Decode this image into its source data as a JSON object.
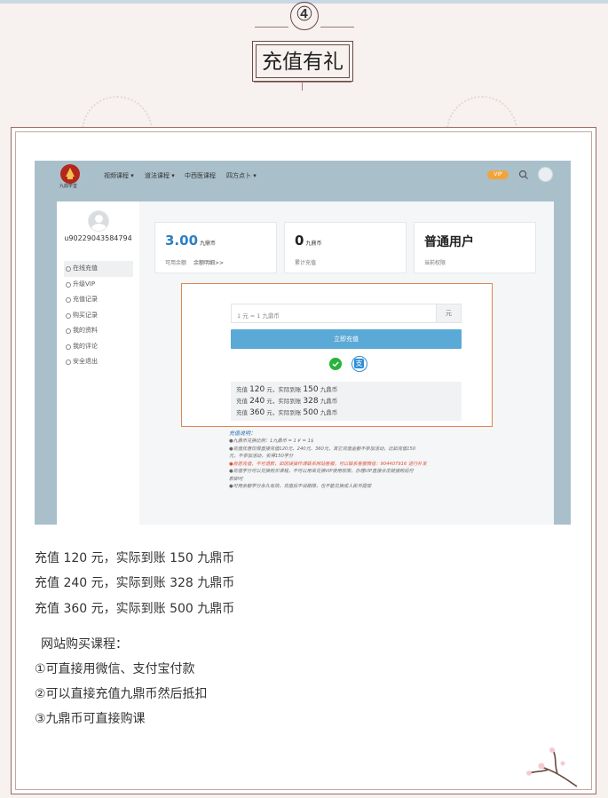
{
  "step": {
    "number": "④"
  },
  "section_title": "充值有礼",
  "screenshot": {
    "nav": {
      "logo_text": "九鼎学堂",
      "items": [
        "视频课程 ▾",
        "道法课程 ▾",
        "中西医课程",
        "四方点卜 ▾"
      ],
      "vip_badge": "VIP"
    },
    "sidebar": {
      "username": "u90229043584794",
      "menu": [
        "在线充值",
        "升级VIP",
        "充值记录",
        "购买记录",
        "我的资料",
        "我的评论",
        "安全退出"
      ]
    },
    "cards": [
      {
        "value": "3.00",
        "unit": "九鼎币",
        "label": "可用余额",
        "link": "余额明细>>"
      },
      {
        "value": "0",
        "unit": "九鼎币",
        "label": "累计充值",
        "link": ""
      },
      {
        "value": "普通用户",
        "unit": "",
        "label": "当前权限",
        "link": ""
      }
    ],
    "pay": {
      "input_placeholder": "1 元 = 1 九鼎币",
      "input_suffix": "元",
      "button": "立即充值",
      "rates": [
        {
          "pre": "充值",
          "a": "120",
          "mid": "元，实际到账",
          "b": "150",
          "post": "九鼎币"
        },
        {
          "pre": "充值",
          "a": "240",
          "mid": "元，实际到账",
          "b": "328",
          "post": "九鼎币"
        },
        {
          "pre": "充值",
          "a": "360",
          "mid": "元，实际到账",
          "b": "500",
          "post": "九鼎币"
        }
      ]
    },
    "notes": {
      "title": "充值说明：",
      "lines": [
        "●九鼎币兑换比例：1九鼎币 = 1￥ = 1$",
        "●充值优惠仅限直接充值120元、240元、360元，其它充值金额不参加活动，比如充值150",
        "元，不参加活动，实得150学分",
        "●自愿充值，不可退款，如因误操作请联系网站客服，可以联系客服微信：904407916 进行补发",
        "●充值学分可以兑换购买课程，不可以用来兑换VIP使用权限，办理VIP直接点击链接购后付",
        "款即可",
        "●可用余额学分永久有效，充值后不设期限，也不能兑换成人民币提现"
      ]
    }
  },
  "promo_lines": [
    "充值 120 元，实际到账 150 九鼎币",
    "充值 240 元，实际到账 328 九鼎币",
    "充值 360 元，实际到账 500 九鼎币"
  ],
  "purchase": {
    "heading": "网站购买课程：",
    "items": [
      "①可直接用微信、支付宝付款",
      "②可以直接充值九鼎币然后抵扣",
      "③九鼎币可直接购课"
    ]
  }
}
